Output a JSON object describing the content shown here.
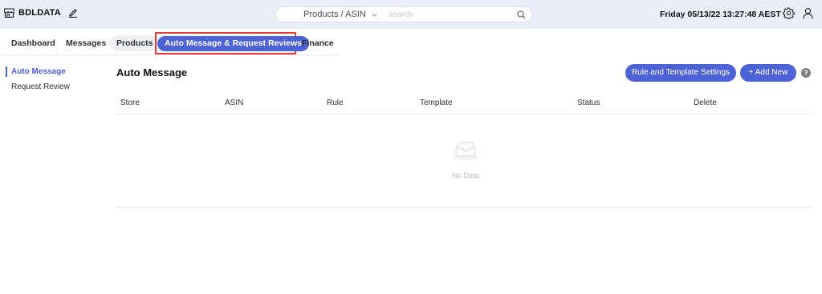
{
  "brand": {
    "name": "BDLDATA"
  },
  "search": {
    "category": "Products / ASIN",
    "placeholder": "search"
  },
  "datetime": "Friday 05/13/22 13:27:48 AEST",
  "tabs": [
    {
      "label": "Dashboard"
    },
    {
      "label": "Messages"
    },
    {
      "label": "Products"
    },
    {
      "label": "Auto Message & Request Reviews"
    },
    {
      "label": "Finance"
    }
  ],
  "sidebar": {
    "items": [
      {
        "label": "Auto Message"
      },
      {
        "label": "Request Review"
      }
    ]
  },
  "main": {
    "title": "Auto Message",
    "rules_button": "Rule and Template Settings",
    "add_button": "+ Add New",
    "help": "?",
    "columns": [
      "Store",
      "ASIN",
      "Rule",
      "Template",
      "Status",
      "Delete"
    ],
    "empty_text": "No Data"
  },
  "colors": {
    "accent": "#4d62d4",
    "topbar": "#e9eef9",
    "highlight": "#e0393e"
  },
  "icons": [
    "store-icon",
    "edit-icon",
    "chevron-down-icon",
    "search-icon",
    "gear-icon",
    "user-icon",
    "help-icon",
    "inbox-icon"
  ]
}
